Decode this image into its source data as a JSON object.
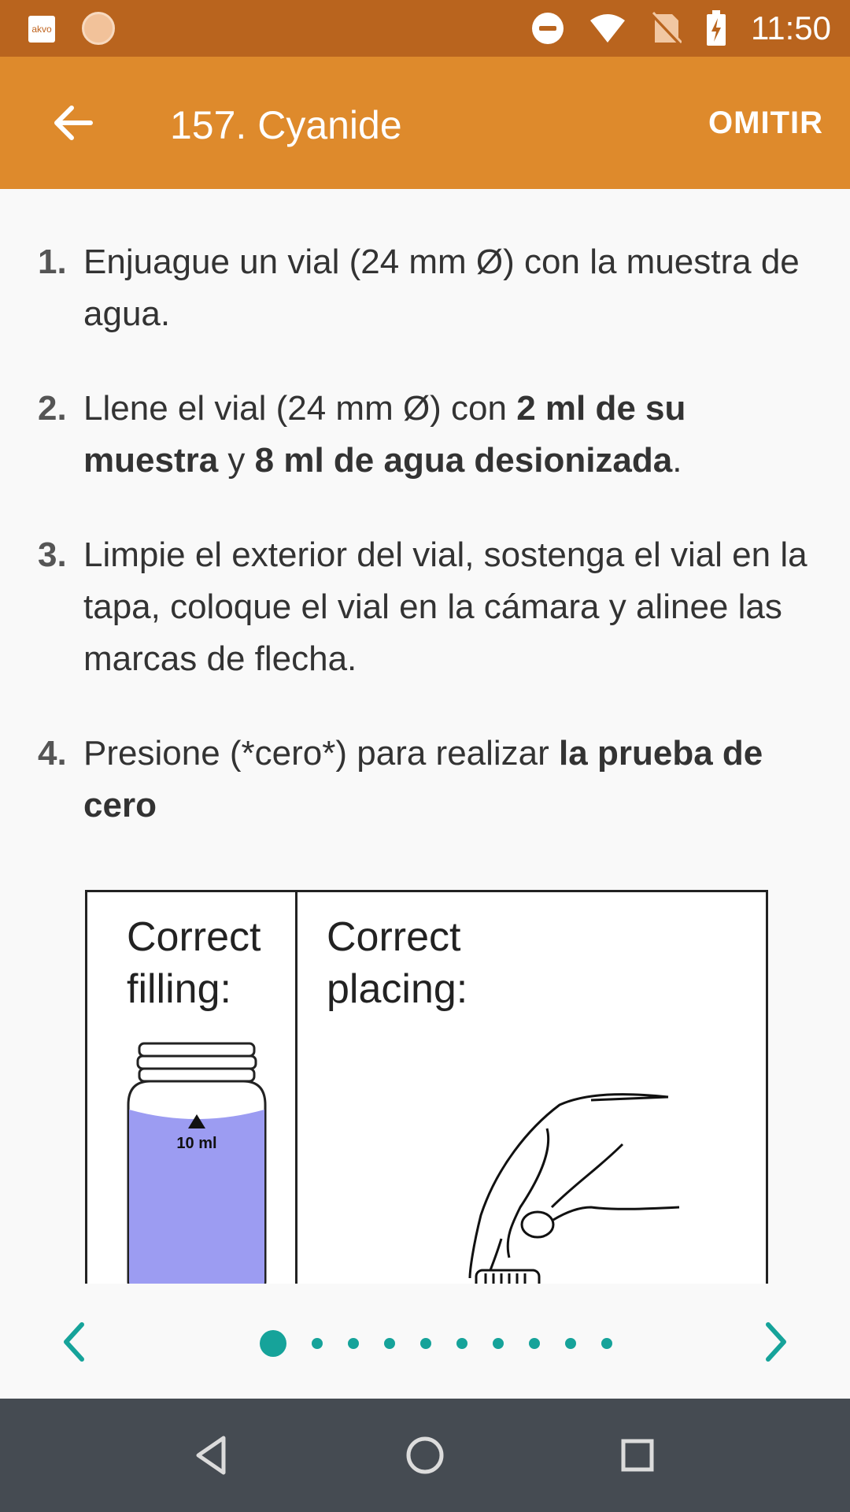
{
  "status_bar": {
    "app_icon_text": "akvo",
    "time": "11:50",
    "icons": [
      "dnd-icon",
      "wifi-icon",
      "no-sim-icon",
      "battery-charging-icon"
    ]
  },
  "app_bar": {
    "title": "157. Cyanide",
    "skip_label": "OMITIR",
    "back_icon": "arrow-left-icon"
  },
  "steps": [
    {
      "num": "1.",
      "parts": [
        {
          "t": "Enjuague un vial (24 mm Ø) con la muestra de agua.",
          "b": false
        }
      ]
    },
    {
      "num": "2.",
      "parts": [
        {
          "t": "Llene el vial (24 mm Ø) con ",
          "b": false
        },
        {
          "t": "2 ml de su muestra",
          "b": true
        },
        {
          "t": " y ",
          "b": false
        },
        {
          "t": "8 ml de agua desionizada",
          "b": true
        },
        {
          "t": ".",
          "b": false
        }
      ]
    },
    {
      "num": "3.",
      "parts": [
        {
          "t": "Limpie el exterior del vial, sostenga el vial en la tapa, coloque el vial en la cámara y alinee las marcas de flecha.",
          "b": false
        }
      ]
    },
    {
      "num": "4.",
      "parts": [
        {
          "t": "Presione (*cero*) para realizar ",
          "b": false
        },
        {
          "t": "la prueba de cero",
          "b": true
        }
      ]
    }
  ],
  "figure": {
    "left_label_line1": "Correct",
    "left_label_line2": "filling:",
    "right_label_line1": "Correct",
    "right_label_line2": "placing:",
    "vial_mark": "10 ml",
    "liquid_color": "#9c9cf2"
  },
  "pager": {
    "total_pages": 10,
    "current_page": 1,
    "accent": "#16a39a"
  },
  "nav_bar": {
    "buttons": [
      "back-triangle-icon",
      "home-circle-icon",
      "recents-square-icon"
    ]
  }
}
